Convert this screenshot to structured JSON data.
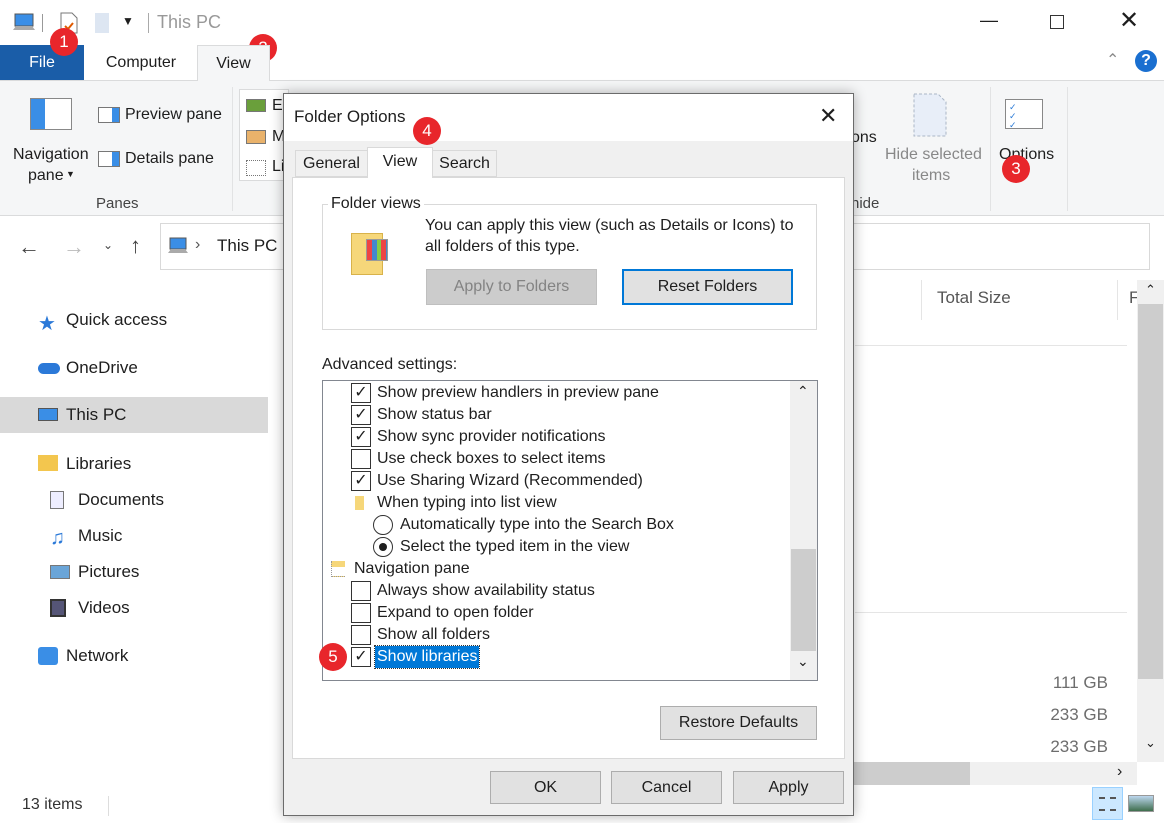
{
  "window": {
    "title": "This PC"
  },
  "ribbon": {
    "tabs": [
      {
        "label": "File"
      },
      {
        "label": "Computer"
      },
      {
        "label": "View"
      }
    ],
    "navigation_pane": "Navigation pane",
    "navigation_pane_line1": "Navigation",
    "navigation_pane_line2": "pane",
    "preview_pane": "Preview pane",
    "details_pane": "Details pane",
    "panes_group": "Panes",
    "layout_items": [
      "Ex",
      "M",
      "Li"
    ],
    "partial_options": "ons",
    "partial_group": "hide",
    "hide_selected_line1": "Hide selected",
    "hide_selected_line2": "items",
    "options": "Options",
    "help": "?"
  },
  "address": {
    "path": "This PC"
  },
  "nav": {
    "items": [
      {
        "label": "Quick access"
      },
      {
        "label": "OneDrive"
      },
      {
        "label": "This PC"
      },
      {
        "label": "Libraries"
      },
      {
        "label": "Documents"
      },
      {
        "label": "Music"
      },
      {
        "label": "Pictures"
      },
      {
        "label": "Videos"
      },
      {
        "label": "Network"
      }
    ]
  },
  "content": {
    "columns": [
      "Total Size",
      "F"
    ],
    "sizes": [
      "111 GB",
      "233 GB",
      "233 GB"
    ]
  },
  "status": {
    "items": "13 items"
  },
  "dialog": {
    "title": "Folder Options",
    "tabs": [
      "General",
      "View",
      "Search"
    ],
    "folder_views": {
      "label": "Folder views",
      "text": "You can apply this view (such as Details or Icons) to all folders of this type.",
      "apply": "Apply to Folders",
      "reset": "Reset Folders"
    },
    "advanced_label": "Advanced settings:",
    "settings": [
      {
        "label": "Show preview handlers in preview pane",
        "type": "checkbox",
        "checked": true
      },
      {
        "label": "Show status bar",
        "type": "checkbox",
        "checked": true
      },
      {
        "label": "Show sync provider notifications",
        "type": "checkbox",
        "checked": true
      },
      {
        "label": "Use check boxes to select items",
        "type": "checkbox",
        "checked": false
      },
      {
        "label": "Use Sharing Wizard (Recommended)",
        "type": "checkbox",
        "checked": true
      },
      {
        "label": "When typing into list view",
        "type": "folder"
      },
      {
        "label": "Automatically type into the Search Box",
        "type": "radio",
        "checked": false
      },
      {
        "label": "Select the typed item in the view",
        "type": "radio",
        "checked": true
      },
      {
        "label": "Navigation pane",
        "type": "group"
      },
      {
        "label": "Always show availability status",
        "type": "checkbox",
        "checked": false
      },
      {
        "label": "Expand to open folder",
        "type": "checkbox",
        "checked": false
      },
      {
        "label": "Show all folders",
        "type": "checkbox",
        "checked": false
      },
      {
        "label": "Show libraries",
        "type": "checkbox",
        "checked": true,
        "selected": true
      }
    ],
    "restore": "Restore Defaults",
    "ok": "OK",
    "cancel": "Cancel",
    "apply": "Apply"
  },
  "badges": [
    "1",
    "2",
    "3",
    "4",
    "5"
  ],
  "colors": {
    "file_tab": "#1a5da8",
    "badge": "#e8262b",
    "selection": "#0078d7",
    "accent_border": "#0078d7"
  }
}
